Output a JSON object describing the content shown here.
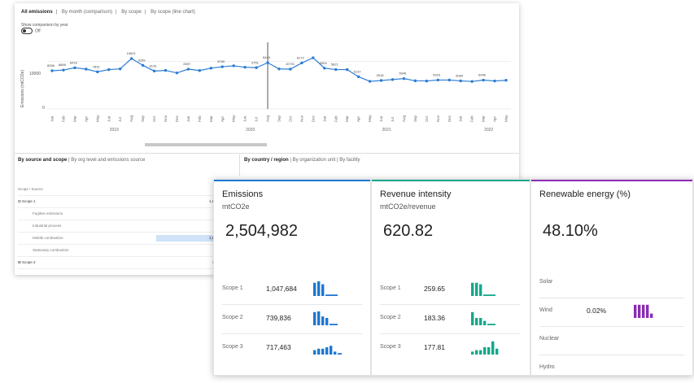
{
  "tabs": [
    "All emissions",
    "By month (comparison)",
    "By scope",
    "By scope (line chart)"
  ],
  "toggle": {
    "label": "Show comparison by year",
    "state": "Off"
  },
  "y_axis_label": "Emissions (mtCO2e)",
  "chart_data": {
    "type": "line",
    "ytick": "10000",
    "months": [
      "Jan",
      "Feb",
      "Mar",
      "Apr",
      "May",
      "Jun",
      "Jul",
      "Aug",
      "Sep",
      "Oct",
      "Nov",
      "Dec",
      "Jan",
      "Feb",
      "Mar",
      "Apr",
      "May",
      "Jun",
      "Jul",
      "Aug",
      "Sep",
      "Oct",
      "Nov",
      "Dec",
      "Jan",
      "Feb",
      "Mar",
      "Apr",
      "May",
      "Jun",
      "Jul",
      "Aug",
      "Sep",
      "Oct",
      "Nov",
      "Dec",
      "Jan",
      "Feb",
      "Mar",
      "Apr",
      "May"
    ],
    "years": [
      "2019",
      "2020",
      "2021",
      "2022"
    ],
    "values": [
      8056,
      8200,
      8688,
      8400,
      7831,
      8300,
      8450,
      10621,
      9199,
      8000,
      8126,
      7600,
      8397,
      8100,
      8600,
      8900,
      9100,
      8800,
      8700,
      9751,
      8440,
      8400,
      9700,
      10791,
      8600,
      8304,
      8300,
      6800,
      5821,
      6000,
      6200,
      6400,
      5946,
      5900,
      6100,
      6100,
      5923,
      5800,
      6080,
      5900,
      6046
    ],
    "labels": [
      "8056",
      "8688",
      "8416",
      "",
      "7831",
      "",
      "",
      "10621",
      "9199",
      "8126",
      "",
      "",
      "8397",
      "",
      "",
      "8760",
      "",
      "",
      "9751",
      "8440",
      "",
      "10791",
      "8172",
      "",
      "8304",
      "5821",
      "",
      "5137",
      "",
      "3518",
      "",
      "5946",
      "",
      "",
      "5923",
      "",
      "6080",
      "",
      "6046",
      "",
      ""
    ],
    "series": [
      {
        "name": "",
        "color": "#2b7cd3"
      }
    ]
  },
  "bottom_left": {
    "tab_active": "By source and scope",
    "tab_other": "By org level and emissions source"
  },
  "bottom_right": {
    "tab_active": "By country / region",
    "tab_other1": "By organization unit",
    "tab_other2": "By facility"
  },
  "table": {
    "header": "Scope / Source",
    "header_val": "Emi",
    "rows": [
      {
        "label": "⊟  Scope 1",
        "value": "1,047,6",
        "highlight": false
      },
      {
        "label": "Fugitive emissions",
        "value": "",
        "highlight": false
      },
      {
        "label": "Industrial process",
        "value": "",
        "highlight": false
      },
      {
        "label": "Mobile combustion",
        "value": "1,045,4",
        "highlight": true
      },
      {
        "label": "Stationary combustion",
        "value": "",
        "highlight": false
      },
      {
        "label": "⊞  Scope 2",
        "value": "739,8",
        "highlight": false
      }
    ]
  },
  "cards": [
    {
      "title": "Emissions",
      "unit": "mtCO2e",
      "value": "2,504,982",
      "color": "#1f77d0",
      "rows": [
        {
          "label": "Scope 1",
          "value": "1,047,684",
          "bars": [
            0.9,
            1,
            0.8,
            0.1,
            0.1,
            0.1
          ]
        },
        {
          "label": "Scope 2",
          "value": "739,836",
          "bars": [
            0.9,
            0.95,
            0.6,
            0.5,
            0.1,
            0.1
          ]
        },
        {
          "label": "Scope 3",
          "value": "717,463",
          "bars": [
            0.3,
            0.4,
            0.4,
            0.5,
            0.6,
            0.2,
            0.1
          ]
        }
      ]
    },
    {
      "title": "Revenue intensity",
      "unit": "mtCO2e/revenue",
      "value": "620.82",
      "color": "#14a88a",
      "rows": [
        {
          "label": "Scope 1",
          "value": "259.65",
          "bars": [
            0.9,
            0.9,
            0.8,
            0.1,
            0.1,
            0.1
          ]
        },
        {
          "label": "Scope 2",
          "value": "183.36",
          "bars": [
            0.9,
            0.5,
            0.5,
            0.3,
            0.1,
            0.1
          ]
        },
        {
          "label": "Scope 3",
          "value": "177.81",
          "bars": [
            0.2,
            0.3,
            0.3,
            0.5,
            0.5,
            0.9,
            0.4
          ]
        }
      ]
    },
    {
      "title": "Renewable energy (%)",
      "unit": "",
      "value": "48.10%",
      "color": "#8a2cb3",
      "rows": [
        {
          "label": "Solar",
          "value": "",
          "bars": []
        },
        {
          "label": "Wind",
          "value": "0.02%",
          "bars": [
            0.9,
            0.9,
            0.9,
            0.9,
            0.3
          ]
        },
        {
          "label": "Nuclear",
          "value": "",
          "bars": []
        },
        {
          "label": "Hydro",
          "value": "",
          "bars": []
        }
      ]
    }
  ]
}
